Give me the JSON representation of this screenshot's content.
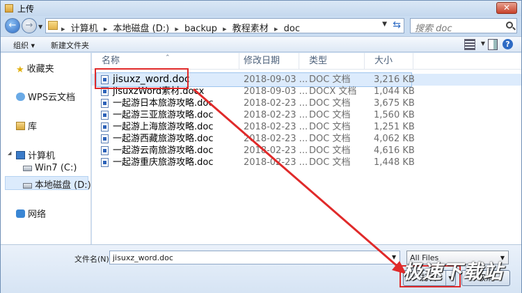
{
  "window": {
    "title": "上传",
    "close_glyph": "✕"
  },
  "address": {
    "crumbs": [
      "计算机",
      "本地磁盘 (D:)",
      "backup",
      "教程素材",
      "doc"
    ],
    "separator": "▸",
    "search_placeholder": "搜索 doc"
  },
  "toolbar": {
    "organize_label": "组织 ▾",
    "new_folder_label": "新建文件夹",
    "help_glyph": "?"
  },
  "sidebar": {
    "favorites": "收藏夹",
    "wps_cloud": "WPS云文档",
    "library": "库",
    "computer": "计算机",
    "drive_c": "Win7 (C:)",
    "drive_d": "本地磁盘 (D:)",
    "network": "网络"
  },
  "columns": {
    "name": "名称",
    "date": "修改日期",
    "type": "类型",
    "size": "大小"
  },
  "files": [
    {
      "name": "jisuxz_word.doc",
      "date": "2018-09-03 ...",
      "type": "DOC 文档",
      "size": "3,216 KB",
      "selected": true
    },
    {
      "name": "jisuxzWord素材.docx",
      "date": "2018-09-03 ...",
      "type": "DOCX 文档",
      "size": "1,044 KB"
    },
    {
      "name": "一起游日本旅游攻略.doc",
      "date": "2018-02-23 ...",
      "type": "DOC 文档",
      "size": "3,675 KB"
    },
    {
      "name": "一起游三亚旅游攻略.doc",
      "date": "2018-02-23 ...",
      "type": "DOC 文档",
      "size": "1,560 KB"
    },
    {
      "name": "一起游上海旅游攻略.doc",
      "date": "2018-02-23 ...",
      "type": "DOC 文档",
      "size": "1,251 KB"
    },
    {
      "name": "一起游西藏旅游攻略.doc",
      "date": "2018-02-23 ...",
      "type": "DOC 文档",
      "size": "4,062 KB"
    },
    {
      "name": "一起游云南旅游攻略.doc",
      "date": "2018-02-23 ...",
      "type": "DOC 文档",
      "size": "4,616 KB"
    },
    {
      "name": "一起游重庆旅游攻略.doc",
      "date": "2018-02-23 ...",
      "type": "DOC 文档",
      "size": "1,448 KB"
    }
  ],
  "bottom": {
    "filename_label": "文件名(N):",
    "filename_value": "jisuxz_word.doc",
    "filter_value": "All Files",
    "open_label": "打开",
    "cancel_label": "取消"
  },
  "watermark": "极速下载站",
  "colors": {
    "annotation": "#e02a2a",
    "selection": "#dcebfc",
    "accent": "#2e6bc4"
  }
}
